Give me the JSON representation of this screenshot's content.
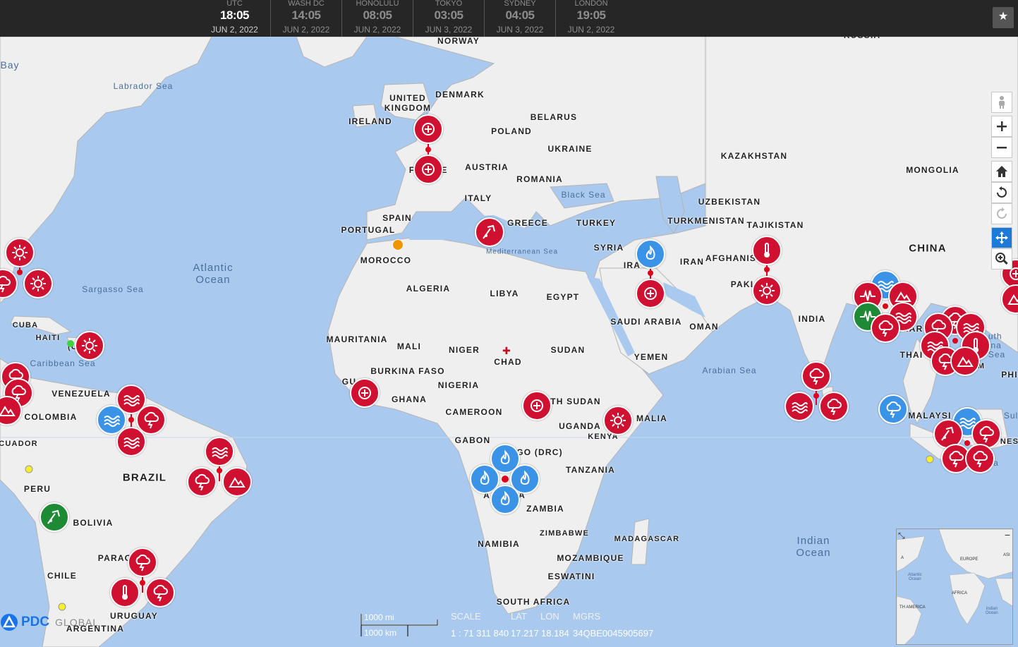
{
  "clocks": [
    {
      "name": "UTC",
      "time": "18:05",
      "date": "JUN 2, 2022",
      "active": true
    },
    {
      "name": "WASH DC",
      "time": "14:05",
      "date": "JUN 2, 2022",
      "active": false
    },
    {
      "name": "HONOLULU",
      "time": "08:05",
      "date": "JUN 2, 2022",
      "active": false
    },
    {
      "name": "TOKYO",
      "time": "03:05",
      "date": "JUN 3, 2022",
      "active": false
    },
    {
      "name": "SYDNEY",
      "time": "04:05",
      "date": "JUN 3, 2022",
      "active": false
    },
    {
      "name": "LONDON",
      "time": "19:05",
      "date": "JUN 2, 2022",
      "active": false
    }
  ],
  "labels": {
    "norway": "NORWAY",
    "russia": "RUSSIA",
    "uk": "UNITED\nKINGDOM",
    "ireland": "IRELAND",
    "denmark": "DENMARK",
    "belarus": "BELARUS",
    "poland": "POLAND",
    "ukraine": "UKRAINE",
    "austria": "AUSTRIA",
    "romania": "ROMANIA",
    "france": "F",
    "france_tail": "E",
    "italy": "ITALY",
    "spain": "SPAIN",
    "portugal": "PORTUGAL",
    "greece": "GREECE",
    "turkey": "TURKEY",
    "morocco": "MOROCCO",
    "algeria": "ALGERIA",
    "libya": "LIBYA",
    "egypt": "EGYPT",
    "syria": "SYRIA",
    "iraq": "IRA",
    "iran": "IRAN",
    "afghanistan": "AFGHANIS",
    "pakistan": "PAKI",
    "kazakhstan": "KAZAKHSTAN",
    "mongolia": "MONGOLIA",
    "uzbekistan": "UZBEKISTAN",
    "turkmenistan": "TURKMENISTAN",
    "tajikistan": "TAJIKISTAN",
    "china": "CHINA",
    "india": "INDIA",
    "saudi": "SAUDI ARABIA",
    "oman": "OMAN",
    "yemen": "YEMEN",
    "mauritania": "MAURITANIA",
    "mali": "MALI",
    "niger": "NIGER",
    "chad": "CHAD",
    "sudan": "SUDAN",
    "burkina": "BURKINA FASO",
    "nigeria": "NIGERIA",
    "ghana": "GHANA",
    "guinea": "GU",
    "cameroon": "CAMEROON",
    "south_sudan": "TH SUDAN",
    "somalia": "MALIA",
    "uganda": "UGANDA",
    "kenya": "KENYA",
    "gabon": "GABON",
    "drc": "GO (DRC)",
    "tanzania": "TANZANIA",
    "angola": "A",
    "angola_tail": "A",
    "zambia": "ZAMBIA",
    "namibia": "NAMIBIA",
    "zimbabwe": "ZIMBABWE",
    "madagascar": "MADAGASCAR",
    "mozambique": "MOZAMBIQUE",
    "eswatini": "ESWATINI",
    "south_africa": "SOUTH AFRICA",
    "cuba": "CUBA",
    "haiti": "HAITI",
    "venezuela": "VENEZUELA",
    "colombia": "COLOMBIA",
    "ecuador": "CUADOR",
    "peru": "PERU",
    "brazil": "BRAZIL",
    "bolivia": "BOLIVIA",
    "paraguay": "PARAG",
    "chile": "CHILE",
    "uruguay": "URUGUAY",
    "argentina": "ARGENTINA",
    "thailand": "THAI",
    "myanmar": "MAR",
    "malaysia": "MALAYSI",
    "philippines": "PHI",
    "indonesia": "NES",
    "sulawesi": "Sul",
    "south_china_sea": "uth\nina\nSea",
    "m_tail": "M",
    "u_tail": "(U"
  },
  "water_labels": {
    "bay": "Bay",
    "labrador": "Labrador Sea",
    "atlantic": "Atlantic\nOcean",
    "sargasso": "Sargasso Sea",
    "caribbean": "Caribbean Sea",
    "black": "Black Sea",
    "mediterranean": "Mediterranean Sea",
    "arabian": "Arabian Sea",
    "indian": "Indian\nOcean",
    "a_tail": "a"
  },
  "scale": {
    "miles": "1000 mi",
    "km": "1000 km"
  },
  "readout": {
    "headers": {
      "scale": "SCALE",
      "lat": "LAT",
      "lon": "LON",
      "mgrs": "MGRS"
    },
    "values": {
      "scale": "1 : 71 311 840",
      "lat": "17.217",
      "lon": "18.184",
      "mgrs": "34QBE0045905697"
    }
  },
  "logo": {
    "text": "PDC",
    "sub": "GLOBAL"
  },
  "overview": {
    "europe": "EUROPE",
    "asia": "ASI",
    "atlantic": "Atlantic\nOcean",
    "africa": "AFRICA",
    "south_america": "TH AMERICA",
    "indian": "Indian\nOcean",
    "a": "A"
  },
  "colors": {
    "hazard_red": "#cf1030",
    "hazard_blue": "#3a93e6",
    "hazard_green": "#1f8a35",
    "water": "#a9c9ee",
    "land": "#efefef"
  },
  "hazards": [
    {
      "type": "biomedical",
      "color": "red"
    },
    {
      "type": "extreme-heat",
      "color": "red"
    },
    {
      "type": "wildfire",
      "color": "blue"
    },
    {
      "type": "earthquake",
      "color": "red"
    },
    {
      "type": "flood",
      "color": "red"
    },
    {
      "type": "storm",
      "color": "red"
    },
    {
      "type": "landslide",
      "color": "red"
    },
    {
      "type": "activity",
      "color": "green"
    }
  ]
}
